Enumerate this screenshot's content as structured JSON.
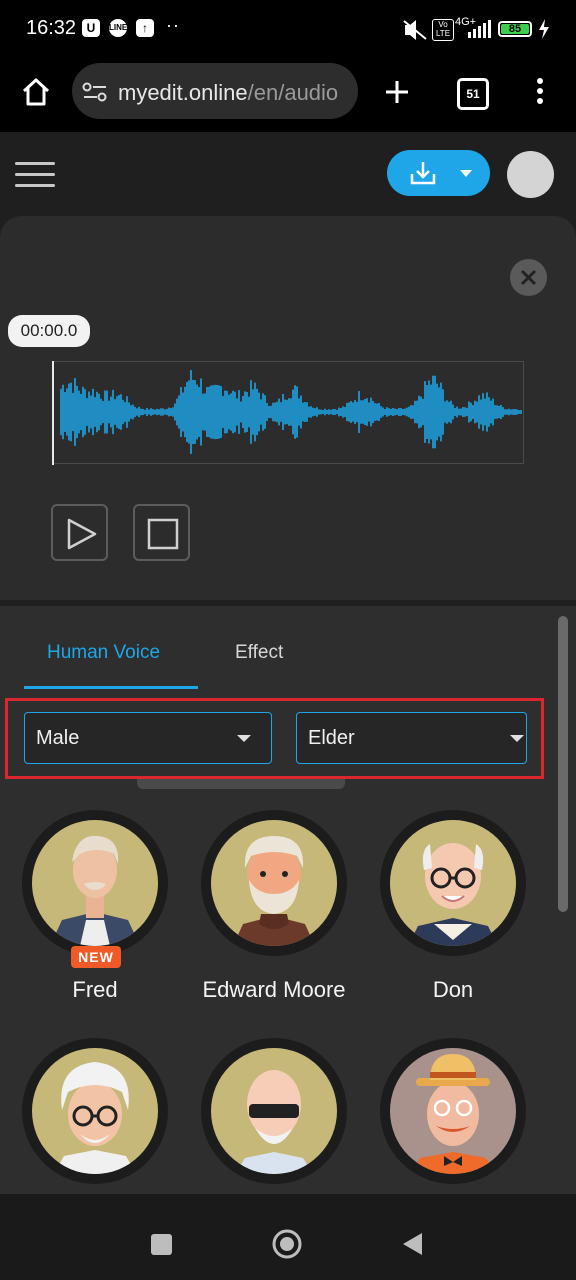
{
  "status_bar": {
    "time": "16:32",
    "battery": "85",
    "network": "4G+",
    "icons": [
      "u-icon",
      "line-icon",
      "upload-icon",
      "dots-icon",
      "mute-icon",
      "volte-icon",
      "signal-icon",
      "battery-icon",
      "charging-icon"
    ]
  },
  "browser": {
    "url_host": "myedit.online",
    "url_path": "/en/audio",
    "tab_count": "51"
  },
  "app_header": {
    "icons": [
      "hamburger-menu-icon",
      "download-icon",
      "chevron-down-icon",
      "user-avatar"
    ]
  },
  "player": {
    "current_time": "00:00.0",
    "colors": {
      "waveform": "#1ea6e8",
      "accent": "#1ea6e8"
    }
  },
  "voice_panel": {
    "tabs": [
      {
        "label": "Human Voice",
        "active": true
      },
      {
        "label": "Effect",
        "active": false
      }
    ],
    "gender_select": {
      "value": "Male"
    },
    "age_select": {
      "value": "Elder"
    },
    "voices": [
      {
        "name": "Fred",
        "badge": "NEW"
      },
      {
        "name": "Edward Moore",
        "badge": ""
      },
      {
        "name": "Don",
        "badge": ""
      },
      {
        "name": "",
        "badge": ""
      },
      {
        "name": "",
        "badge": ""
      },
      {
        "name": "",
        "badge": ""
      }
    ]
  }
}
